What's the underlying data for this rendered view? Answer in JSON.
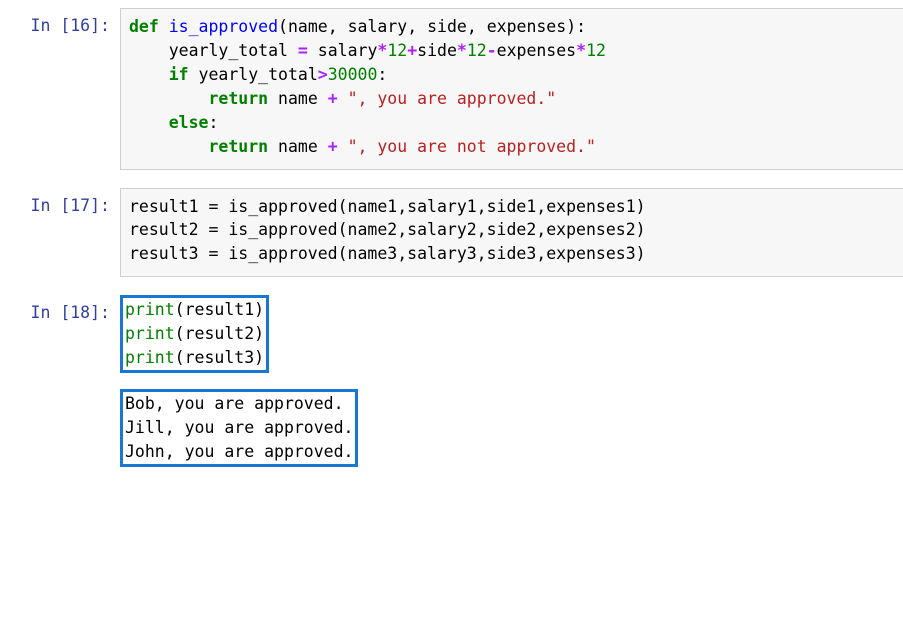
{
  "cells": {
    "c16": {
      "prompt": "In [16]:",
      "tokens": {
        "def": "def",
        "funcname": "is_approved",
        "lparen": "(",
        "p1": "name",
        "c1": ", ",
        "p2": "salary",
        "c2": ", ",
        "p3": "side",
        "c3": ", ",
        "p4": "expenses",
        "rparen_colon": "):",
        "l2_var": "yearly_total",
        "l2_eq": " = ",
        "l2_a": "salary",
        "l2_op1": "*",
        "l2_n1": "12",
        "l2_op2": "+",
        "l2_b": "side",
        "l2_op3": "*",
        "l2_n2": "12",
        "l2_op4": "-",
        "l2_c": "expenses",
        "l2_op5": "*",
        "l2_n3": "12",
        "if": "if",
        "l3_var": " yearly_total",
        "l3_op": ">",
        "l3_n": "30000",
        "l3_colon": ":",
        "return1": "return",
        "l4_a": " name ",
        "l4_op": "+",
        "l4_str": " \", you are approved.\"",
        "else": "else",
        "l5_colon": ":",
        "return2": "return",
        "l6_a": " name ",
        "l6_op": "+",
        "l6_str": " \", you are not approved.\""
      }
    },
    "c17": {
      "prompt": "In [17]:",
      "line1": "result1 = is_approved(name1,salary1,side1,expenses1)",
      "line2": "result2 = is_approved(name2,salary2,side2,expenses2)",
      "line3": "result3 = is_approved(name3,salary3,side3,expenses3)"
    },
    "c18": {
      "prompt": "In [18]:",
      "print": "print",
      "arg1": "(result1)",
      "arg2": "(result2)",
      "arg3": "(result3)",
      "out1": "Bob, you are approved.",
      "out2": "Jill, you are approved.",
      "out3": "John, you are approved."
    }
  }
}
